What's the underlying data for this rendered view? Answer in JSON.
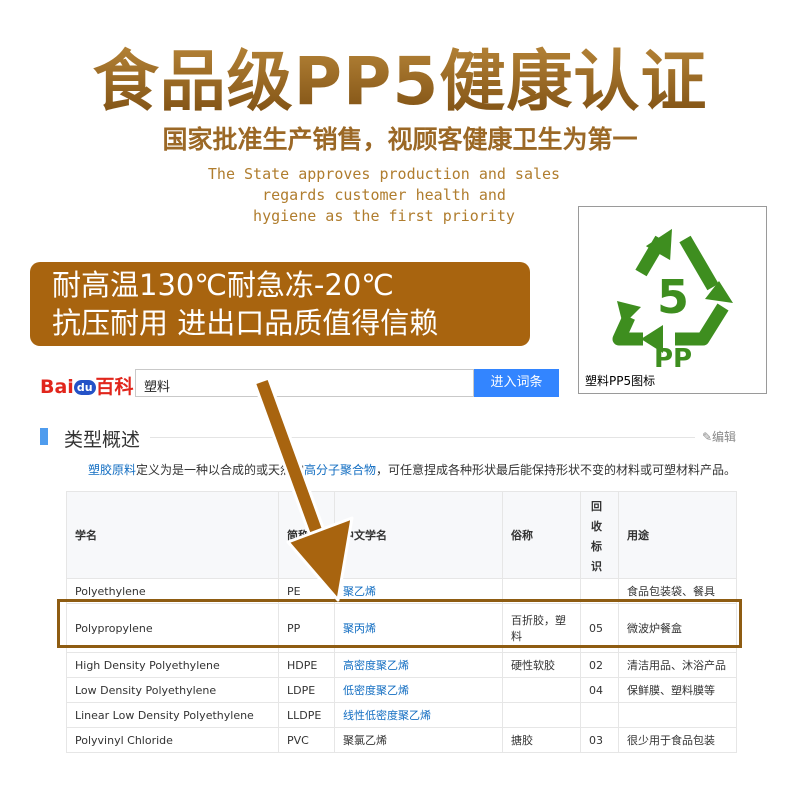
{
  "header": {
    "title": "食品级PP5健康认证",
    "subtitle": "国家批准生产销售，视顾客健康卫生为第一",
    "english_lines": [
      "The State approves production and sales",
      "regards customer health and",
      "hygiene as the first priority"
    ]
  },
  "banner": {
    "line1": "耐高温130℃耐急冻-20℃",
    "line2": "抗压耐用 进出口品质值得信赖"
  },
  "recycle_badge": {
    "number": "5",
    "code": "PP",
    "caption": "塑料PP5图标",
    "color": "#3e8e1f"
  },
  "search": {
    "logo_left": "Bai",
    "logo_du": "du",
    "logo_right": "百科",
    "query": "塑料",
    "button_label": "进入词条"
  },
  "section": {
    "title": "类型概述",
    "edit_label": "✎编辑",
    "desc_link1": "塑胶原料",
    "desc_mid": "定义为是一种以合成的或天然的",
    "desc_link2": "高分子聚合物",
    "desc_end": "，可任意捏成各种形状最后能保持形状不变的材料或可塑材料产品。"
  },
  "table": {
    "headers": [
      "学名",
      "简称",
      "中文学名",
      "俗称",
      "回收标识",
      "用途"
    ],
    "recycle_header_chars": [
      "回",
      "收",
      "标",
      "识"
    ],
    "rows": [
      {
        "name": "Polyethylene",
        "abbr": "PE",
        "cn": "聚乙烯",
        "common": "",
        "code": "",
        "use": "食品包装袋、餐具"
      },
      {
        "name": "Polypropylene",
        "abbr": "PP",
        "cn": "聚丙烯",
        "common": "百折胶，塑料",
        "code": "05",
        "use": "微波炉餐盒"
      },
      {
        "name": "High Density Polyethylene",
        "abbr": "HDPE",
        "cn": "高密度聚乙烯",
        "common": "硬性软胶",
        "code": "02",
        "use": "清洁用品、沐浴产品"
      },
      {
        "name": "Low Density Polyethylene",
        "abbr": "LDPE",
        "cn": "低密度聚乙烯",
        "common": "",
        "code": "04",
        "use": "保鲜膜、塑料膜等"
      },
      {
        "name": "Linear Low Density Polyethylene",
        "abbr": "LLDPE",
        "cn": "线性低密度聚乙烯",
        "common": "",
        "code": "",
        "use": ""
      },
      {
        "name": "Polyvinyl Chloride",
        "abbr": "PVC",
        "cn": "聚氯乙烯",
        "common": "搪胶",
        "code": "03",
        "use": "很少用于食品包装"
      }
    ]
  },
  "colors": {
    "accent_brown": "#a8640f",
    "link_blue": "#136ec2",
    "button_blue": "#3385ff"
  }
}
